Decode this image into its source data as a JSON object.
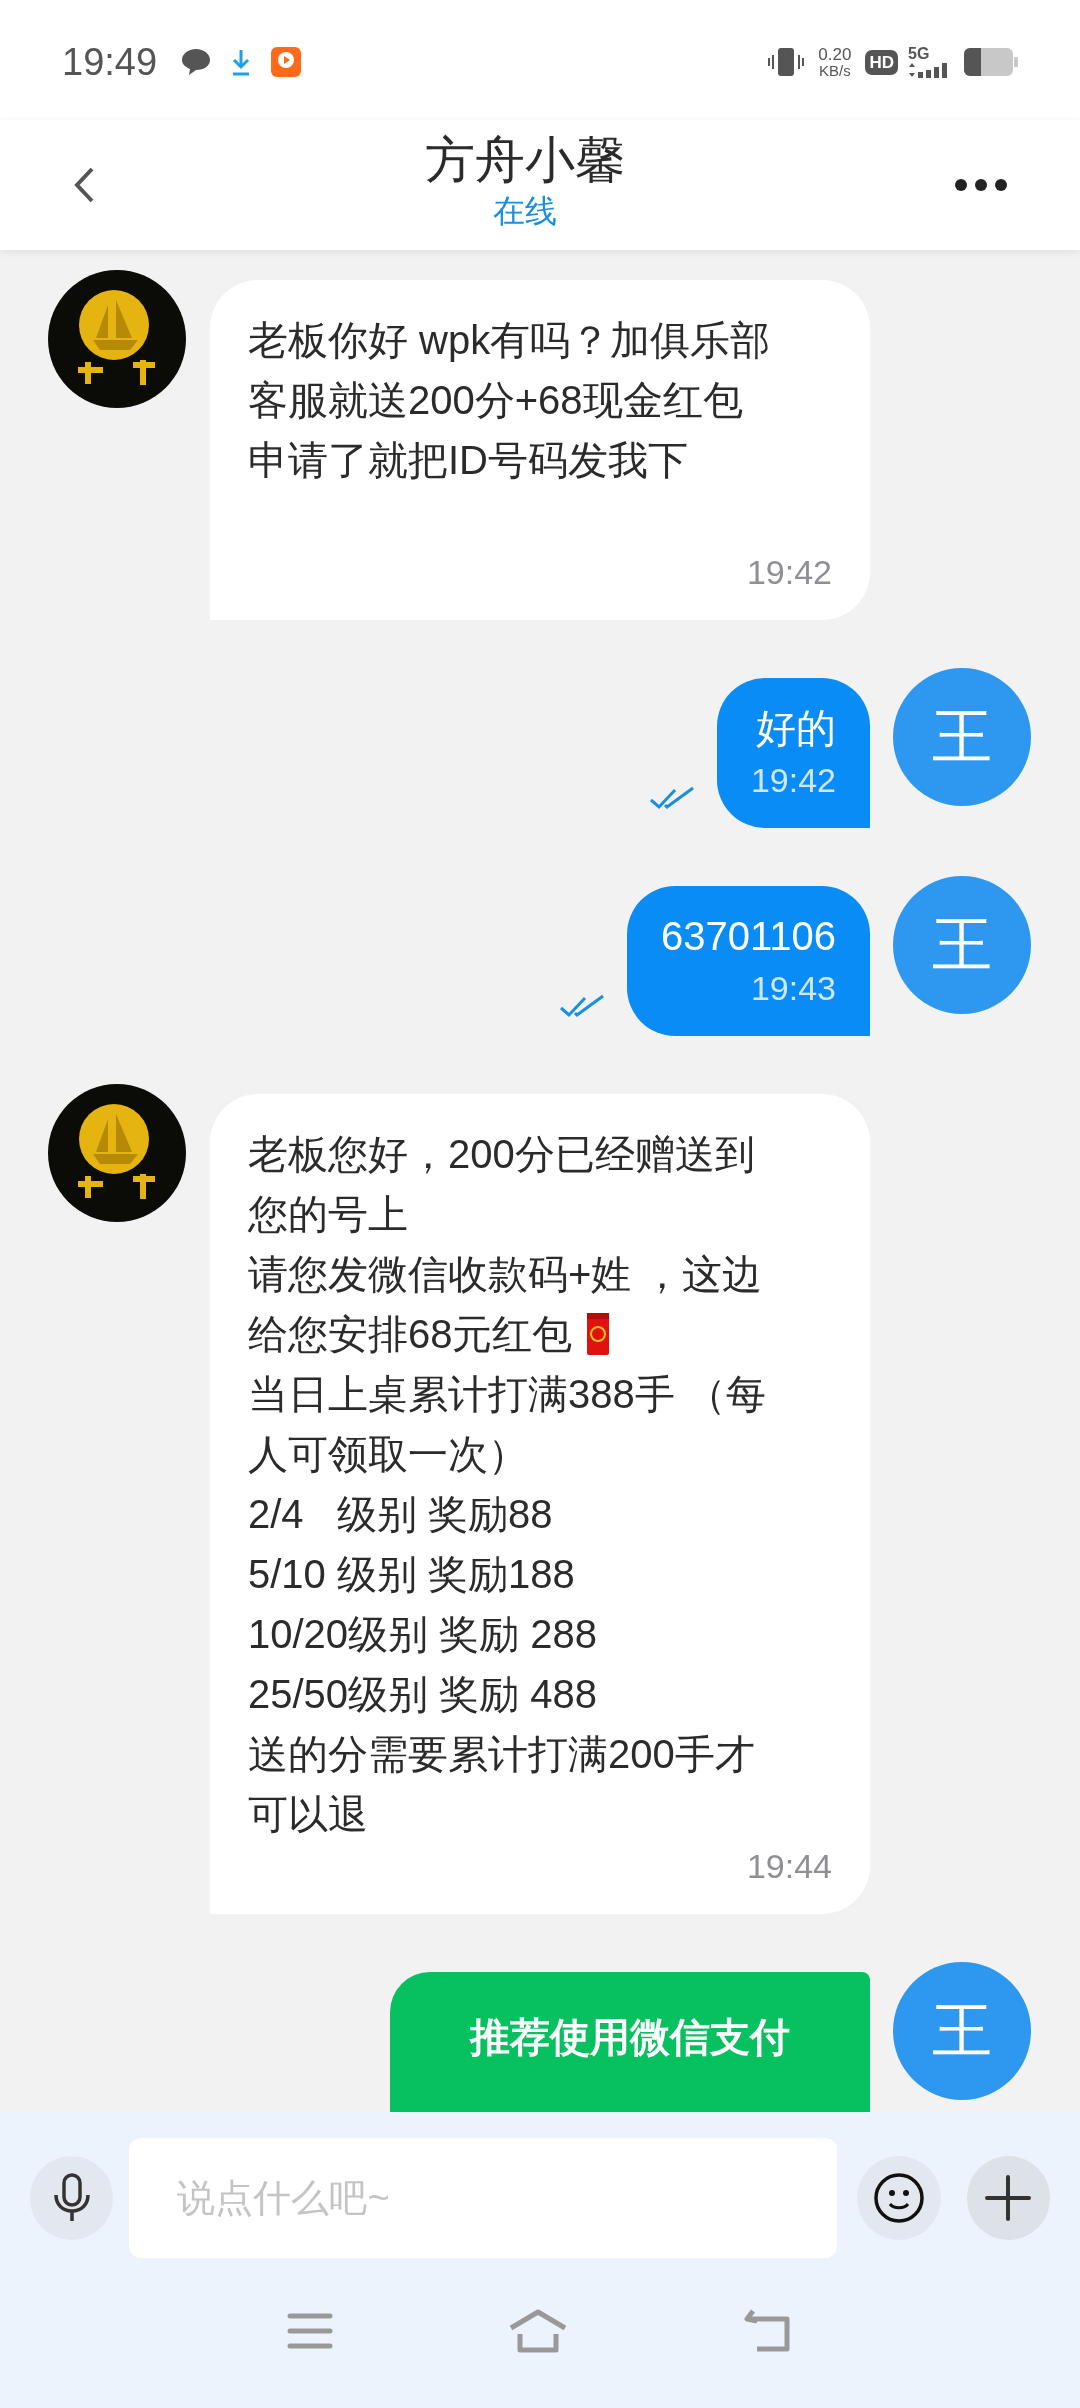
{
  "status_bar": {
    "time": "19:49",
    "net_speed": "0.20",
    "net_unit": "KB/s",
    "hd": "HD",
    "network": "5G"
  },
  "header": {
    "title": "方舟小馨",
    "status": "在线"
  },
  "messages": [
    {
      "from_me": false,
      "kind": "text",
      "avatar": {
        "kind": "logo"
      },
      "lines": [
        {
          "text": "老板你好 wpk有吗？加俱乐部"
        },
        {
          "text": "客服就送200分+68现金红包"
        },
        {
          "text": "申请了就把ID号码发我下"
        }
      ],
      "time": "19:42"
    },
    {
      "from_me": true,
      "kind": "text",
      "avatar": {
        "kind": "letter",
        "text": "王"
      },
      "lines": [
        {
          "text": "好的"
        }
      ],
      "time": "19:42",
      "read": true
    },
    {
      "from_me": true,
      "kind": "text",
      "avatar": {
        "kind": "letter",
        "text": "王"
      },
      "lines": [
        {
          "text": "63701106"
        }
      ],
      "time": "19:43",
      "read": true
    },
    {
      "from_me": false,
      "kind": "text",
      "avatar": {
        "kind": "logo"
      },
      "lines": [
        {
          "text": "老板您好，200分已经赠送到"
        },
        {
          "text": "您的号上"
        },
        {
          "text": "请您发微信收款码+姓 ，这边"
        },
        {
          "text": "给您安排68元红包",
          "kind": "with_envelope"
        },
        {
          "text": "当日上桌累计打满388手 （每"
        },
        {
          "text": "人可领取一次）"
        },
        {
          "text": "2/4   级别 奖励88"
        },
        {
          "text": "5/10 级别 奖励188"
        },
        {
          "text": "10/20级别 奖励 288"
        },
        {
          "text": "25/50级别 奖励 488"
        },
        {
          "text": "送的分需要累计打满200手才"
        },
        {
          "text": "可以退"
        }
      ],
      "time": "19:44"
    },
    {
      "from_me": true,
      "kind": "pay_card",
      "avatar": {
        "kind": "letter",
        "text": "王"
      },
      "text": "推荐使用微信支付"
    }
  ],
  "composer": {
    "placeholder": "说点什么吧~"
  }
}
